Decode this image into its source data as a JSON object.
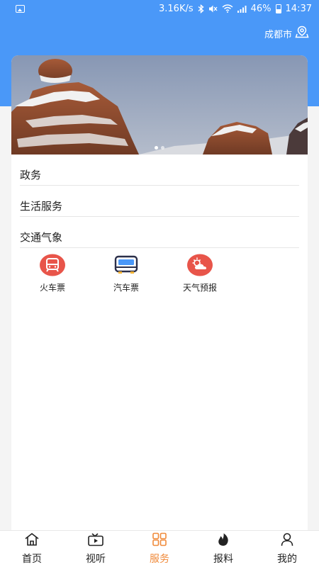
{
  "status_bar": {
    "net_speed": "3.16K/s",
    "battery": "46%",
    "time": "14:37"
  },
  "header": {
    "city": "成都市"
  },
  "banner": {
    "slides": 2,
    "active_slide": 1
  },
  "sections": [
    {
      "title": "政务"
    },
    {
      "title": "生活服务"
    },
    {
      "title": "交通气象"
    }
  ],
  "transport_services": [
    {
      "label": "火车票",
      "icon": "train-icon",
      "color": "#e8554a"
    },
    {
      "label": "汽车票",
      "icon": "bus-icon",
      "color": "#2b2f4a"
    },
    {
      "label": "天气预报",
      "icon": "weather-icon",
      "color": "#e8554a"
    }
  ],
  "tabbar": {
    "active_color": "#f08a3a",
    "items": [
      {
        "label": "首页",
        "icon": "home-icon"
      },
      {
        "label": "视听",
        "icon": "tv-icon"
      },
      {
        "label": "服务",
        "icon": "grid-icon",
        "active": true
      },
      {
        "label": "报料",
        "icon": "fire-icon"
      },
      {
        "label": "我的",
        "icon": "user-icon"
      }
    ]
  }
}
